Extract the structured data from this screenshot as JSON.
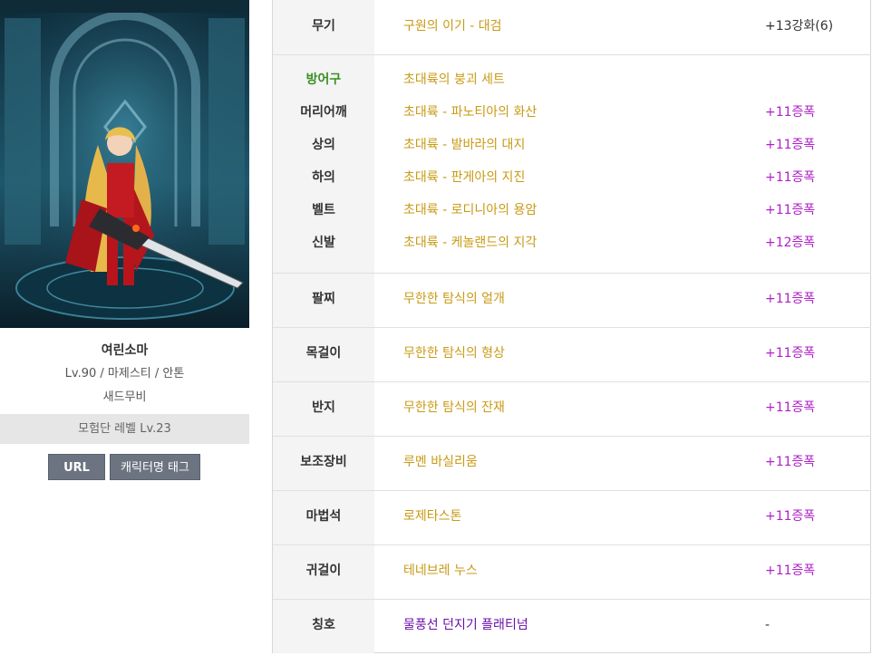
{
  "character": {
    "name": "여린소마",
    "info": "Lv.90 / 마제스티 / 안톤",
    "guild": "새드무비",
    "adventure_level": "모험단 레벨 Lv.23",
    "url_button": "URL",
    "tag_button": "캐릭터명 태그"
  },
  "equipment": {
    "weapon": {
      "slot": "무기",
      "item": "구원의 이기 - 대검",
      "enhance": "+13강화(6)"
    },
    "armor_header": {
      "slot": "방어구",
      "item": "초대륙의 붕괴 세트"
    },
    "armor": [
      {
        "slot": "머리어깨",
        "item": "초대륙 - 파노티아의 화산",
        "enhance": "+11증폭"
      },
      {
        "slot": "상의",
        "item": "초대륙 - 발바라의 대지",
        "enhance": "+11증폭"
      },
      {
        "slot": "하의",
        "item": "초대륙 - 판게아의 지진",
        "enhance": "+11증폭"
      },
      {
        "slot": "벨트",
        "item": "초대륙 - 로디니아의 용암",
        "enhance": "+11증폭"
      },
      {
        "slot": "신발",
        "item": "초대륙 - 케놀랜드의 지각",
        "enhance": "+12증폭"
      }
    ],
    "bracelet": {
      "slot": "팔찌",
      "item": "무한한 탐식의 얼개",
      "enhance": "+11증폭"
    },
    "necklace": {
      "slot": "목걸이",
      "item": "무한한 탐식의 형상",
      "enhance": "+11증폭"
    },
    "ring": {
      "slot": "반지",
      "item": "무한한 탐식의 잔재",
      "enhance": "+11증폭"
    },
    "sub": {
      "slot": "보조장비",
      "item": "루멘 바실리움",
      "enhance": "+11증폭"
    },
    "magic_stone": {
      "slot": "마법석",
      "item": "로제타스톤",
      "enhance": "+11증폭"
    },
    "earring": {
      "slot": "귀걸이",
      "item": "테네브레 누스",
      "enhance": "+11증폭"
    },
    "title": {
      "slot": "칭호",
      "item": "물풍선 던지기 플래티넘",
      "enhance": "-"
    }
  },
  "colors": {
    "item_text": "#c89a14",
    "amplify_text": "#b020c8",
    "set_label": "#3a8f26",
    "title_item": "#6a0fa8",
    "button_bg": "#6b7480"
  }
}
